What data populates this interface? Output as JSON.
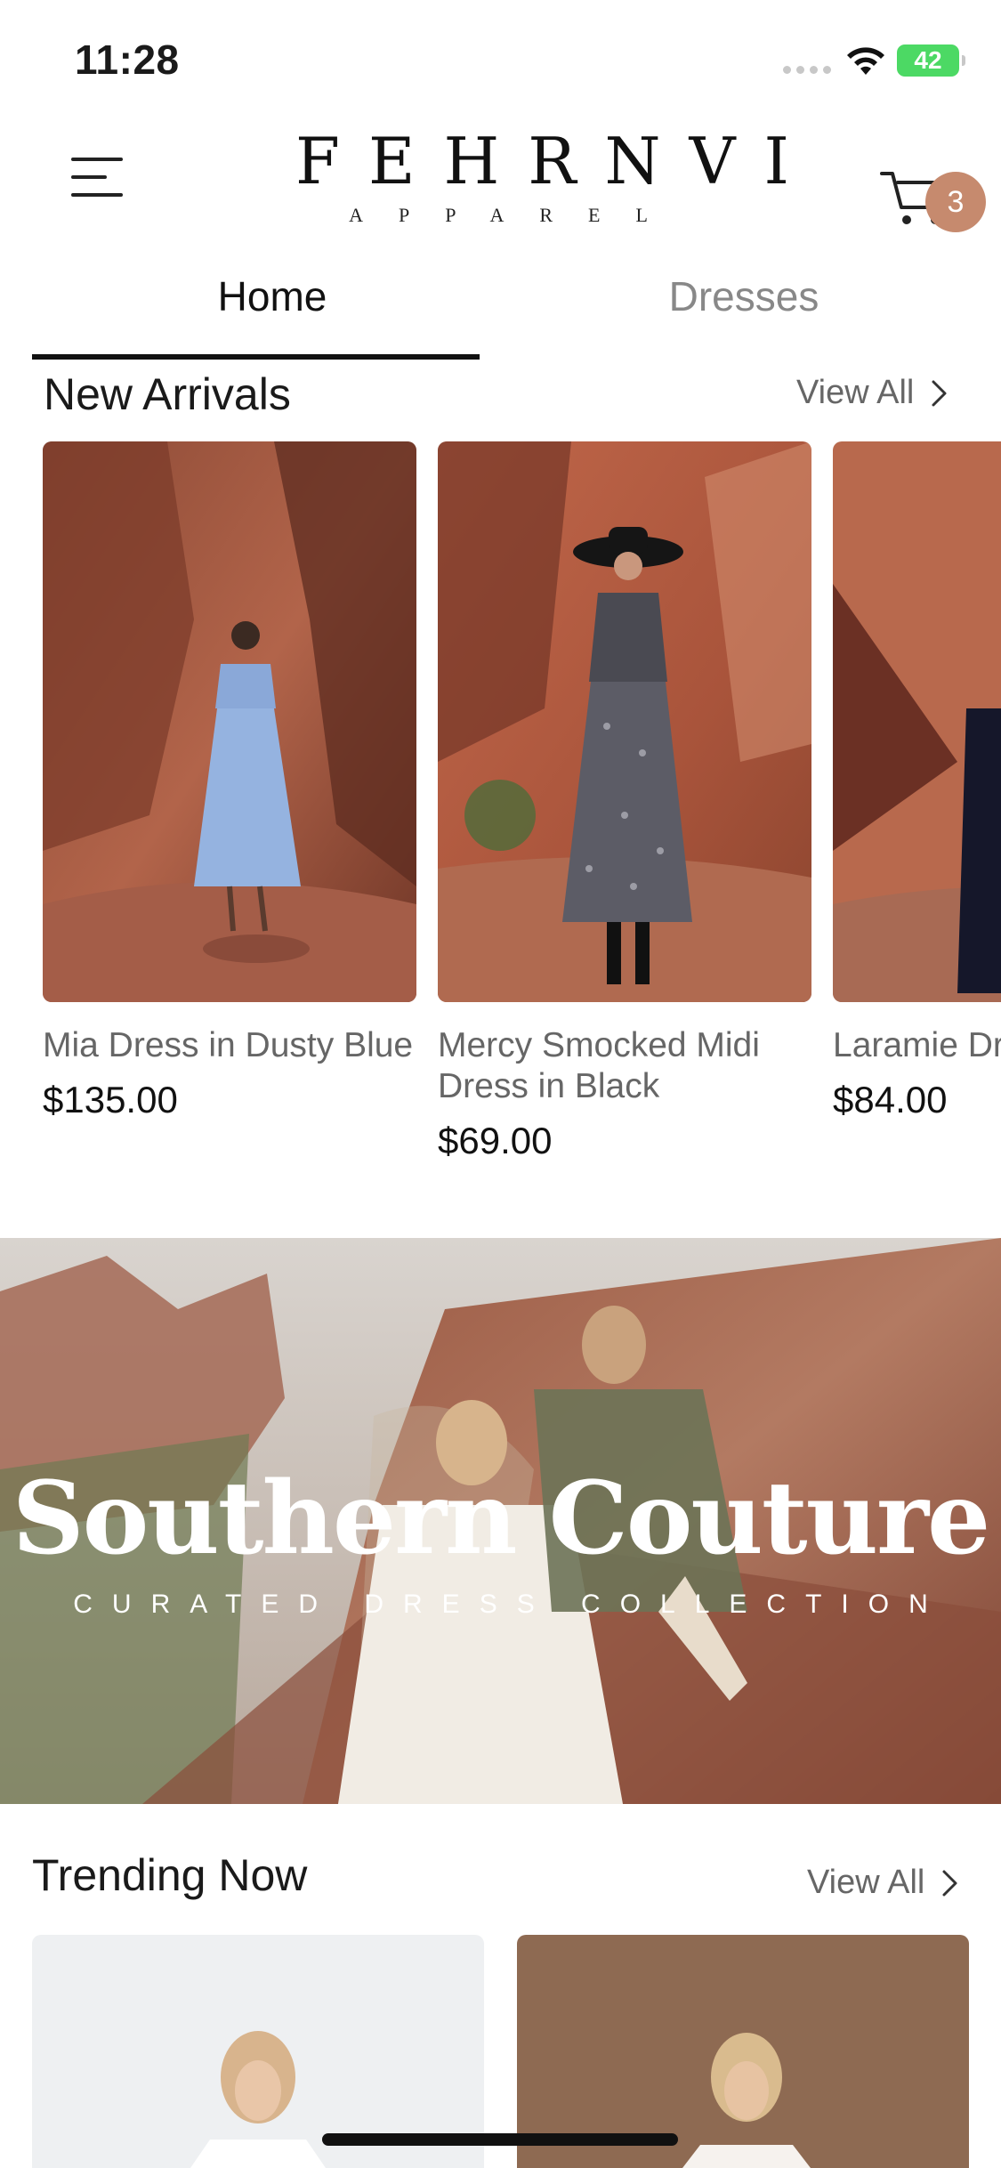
{
  "status_bar": {
    "time": "11:28",
    "battery": "42"
  },
  "brand": {
    "name": "FEHRNVI",
    "tagline": "APPAREL"
  },
  "cart": {
    "count": "3"
  },
  "tabs": [
    {
      "label": "Home"
    },
    {
      "label": "Dresses"
    }
  ],
  "new_arrivals": {
    "title": "New Arrivals",
    "view_all": "View All",
    "products": [
      {
        "name": "Mia Dress in Dusty Blue",
        "price": "$135.00"
      },
      {
        "name": "Mercy Smocked Midi Dress in Black",
        "price": "$69.00"
      },
      {
        "name": "Laramie Dr",
        "price": "$84.00"
      }
    ]
  },
  "banner": {
    "title": "Southern Couture",
    "subtitle": "CURATED DRESS COLLECTION"
  },
  "trending": {
    "title": "Trending Now",
    "view_all": "View All"
  },
  "colors": {
    "accent": "#c68a6e",
    "text": "#1a1a1a",
    "muted": "#666666",
    "battery": "#4cd964"
  },
  "icons": [
    "menu-icon",
    "cart-icon",
    "chevron-right-icon",
    "wifi-icon",
    "battery-icon"
  ]
}
